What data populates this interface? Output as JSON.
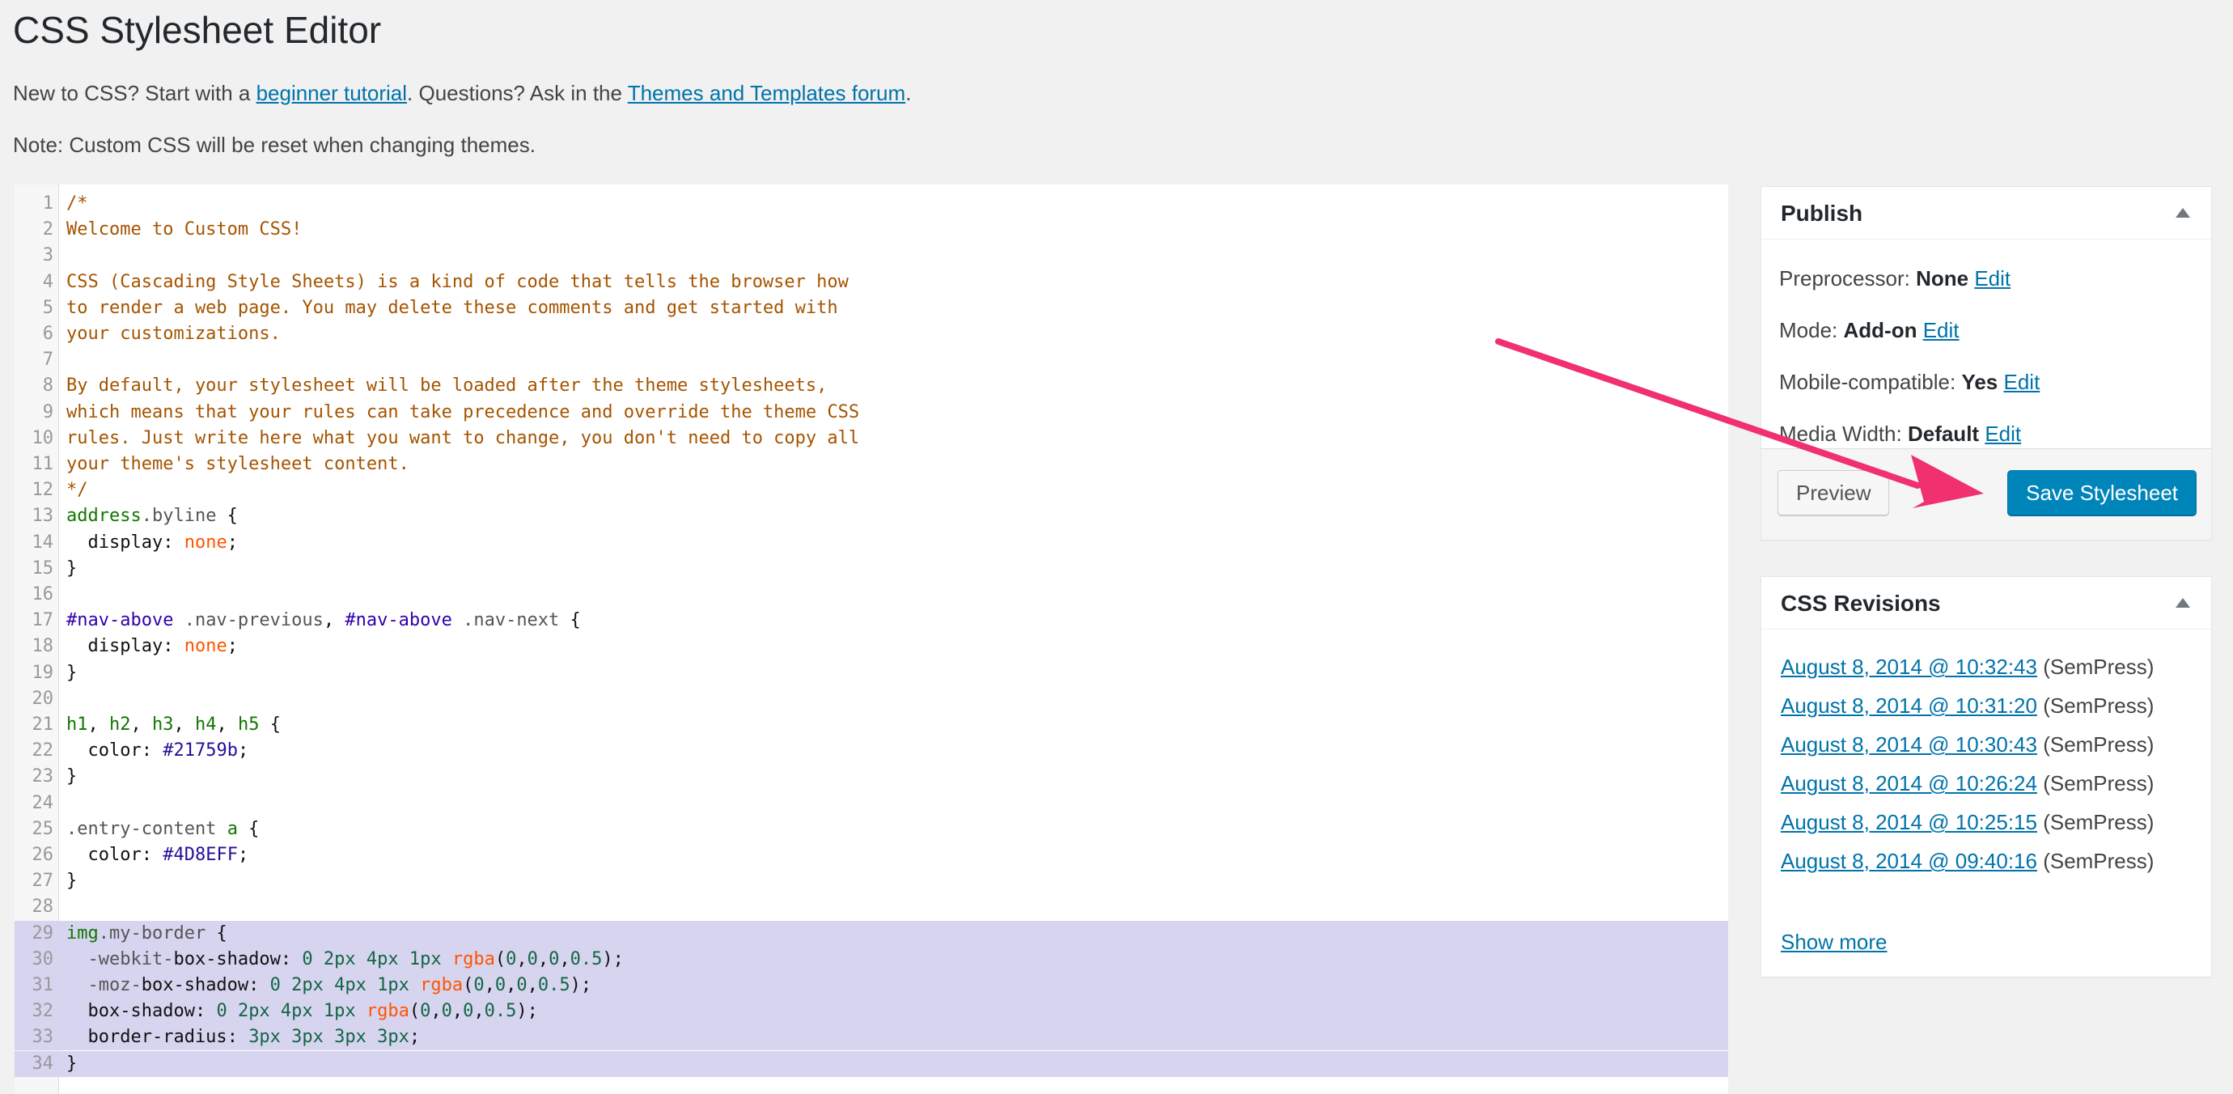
{
  "page": {
    "title": "CSS Stylesheet Editor",
    "intro_prefix": "New to CSS? Start with a ",
    "intro_link1": "beginner tutorial",
    "intro_middle": ". Questions? Ask in the ",
    "intro_link2": "Themes and Templates forum",
    "intro_suffix": ".",
    "note": "Note: Custom CSS will be reset when changing themes."
  },
  "editor": {
    "selected_lines": [
      29,
      30,
      31,
      32,
      33,
      34
    ],
    "lines": [
      [
        [
          "comment",
          "/*"
        ]
      ],
      [
        [
          "comment",
          "Welcome to Custom CSS!"
        ]
      ],
      [],
      [
        [
          "comment",
          "CSS (Cascading Style Sheets) is a kind of code that tells the browser how"
        ]
      ],
      [
        [
          "comment",
          "to render a web page. You may delete these comments and get started with"
        ]
      ],
      [
        [
          "comment",
          "your customizations."
        ]
      ],
      [],
      [
        [
          "comment",
          "By default, your stylesheet will be loaded after the theme stylesheets,"
        ]
      ],
      [
        [
          "comment",
          "which means that your rules can take precedence and override the theme CSS"
        ]
      ],
      [
        [
          "comment",
          "rules. Just write here what you want to change, you don't need to copy all"
        ]
      ],
      [
        [
          "comment",
          "your theme's stylesheet content."
        ]
      ],
      [
        [
          "comment",
          "*/"
        ]
      ],
      [
        [
          "tag",
          "address"
        ],
        [
          "qual",
          ".byline"
        ],
        [
          "punc",
          " {"
        ]
      ],
      [
        [
          "prop",
          "  display"
        ],
        [
          "punc",
          ": "
        ],
        [
          "atom",
          "none"
        ],
        [
          "punc",
          ";"
        ]
      ],
      [
        [
          "punc",
          "}"
        ]
      ],
      [],
      [
        [
          "builtin",
          "#nav-above"
        ],
        [
          "qual",
          " .nav-previous"
        ],
        [
          "punc",
          ", "
        ],
        [
          "builtin",
          "#nav-above"
        ],
        [
          "qual",
          " .nav-next"
        ],
        [
          "punc",
          " {"
        ]
      ],
      [
        [
          "prop",
          "  display"
        ],
        [
          "punc",
          ": "
        ],
        [
          "atom",
          "none"
        ],
        [
          "punc",
          ";"
        ]
      ],
      [
        [
          "punc",
          "}"
        ]
      ],
      [],
      [
        [
          "tag",
          "h1"
        ],
        [
          "punc",
          ", "
        ],
        [
          "tag",
          "h2"
        ],
        [
          "punc",
          ", "
        ],
        [
          "tag",
          "h3"
        ],
        [
          "punc",
          ", "
        ],
        [
          "tag",
          "h4"
        ],
        [
          "punc",
          ", "
        ],
        [
          "tag",
          "h5"
        ],
        [
          "punc",
          " {"
        ]
      ],
      [
        [
          "prop",
          "  color"
        ],
        [
          "punc",
          ": "
        ],
        [
          "hex",
          "#21759b"
        ],
        [
          "punc",
          ";"
        ]
      ],
      [
        [
          "punc",
          "}"
        ]
      ],
      [],
      [
        [
          "qual",
          ".entry-content"
        ],
        [
          "punc",
          " "
        ],
        [
          "tag",
          "a"
        ],
        [
          "punc",
          " {"
        ]
      ],
      [
        [
          "prop",
          "  color"
        ],
        [
          "punc",
          ": "
        ],
        [
          "hex",
          "#4D8EFF"
        ],
        [
          "punc",
          ";"
        ]
      ],
      [
        [
          "punc",
          "}"
        ]
      ],
      [],
      [
        [
          "tag",
          "img"
        ],
        [
          "qual",
          ".my-border"
        ],
        [
          "punc",
          " {"
        ]
      ],
      [
        [
          "qual",
          "  -webkit-"
        ],
        [
          "prop",
          "box-shadow"
        ],
        [
          "punc",
          ": "
        ],
        [
          "num",
          "0 2px 4px 1px"
        ],
        [
          "punc",
          " "
        ],
        [
          "atom",
          "rgba"
        ],
        [
          "punc",
          "("
        ],
        [
          "num",
          "0"
        ],
        [
          "punc",
          ","
        ],
        [
          "num",
          "0"
        ],
        [
          "punc",
          ","
        ],
        [
          "num",
          "0"
        ],
        [
          "punc",
          ","
        ],
        [
          "num",
          "0.5"
        ],
        [
          "punc",
          ");"
        ]
      ],
      [
        [
          "qual",
          "  -moz-"
        ],
        [
          "prop",
          "box-shadow"
        ],
        [
          "punc",
          ": "
        ],
        [
          "num",
          "0 2px 4px 1px"
        ],
        [
          "punc",
          " "
        ],
        [
          "atom",
          "rgba"
        ],
        [
          "punc",
          "("
        ],
        [
          "num",
          "0"
        ],
        [
          "punc",
          ","
        ],
        [
          "num",
          "0"
        ],
        [
          "punc",
          ","
        ],
        [
          "num",
          "0"
        ],
        [
          "punc",
          ","
        ],
        [
          "num",
          "0.5"
        ],
        [
          "punc",
          ");"
        ]
      ],
      [
        [
          "prop",
          "  box-shadow"
        ],
        [
          "punc",
          ": "
        ],
        [
          "num",
          "0 2px 4px 1px"
        ],
        [
          "punc",
          " "
        ],
        [
          "atom",
          "rgba"
        ],
        [
          "punc",
          "("
        ],
        [
          "num",
          "0"
        ],
        [
          "punc",
          ","
        ],
        [
          "num",
          "0"
        ],
        [
          "punc",
          ","
        ],
        [
          "num",
          "0"
        ],
        [
          "punc",
          ","
        ],
        [
          "num",
          "0.5"
        ],
        [
          "punc",
          ");"
        ]
      ],
      [
        [
          "prop",
          "  border-radius"
        ],
        [
          "punc",
          ": "
        ],
        [
          "num",
          "3px 3px 3px 3px"
        ],
        [
          "punc",
          ";"
        ]
      ],
      [
        [
          "punc",
          "}"
        ]
      ]
    ]
  },
  "publish": {
    "title": "Publish",
    "rows": [
      {
        "label": "Preprocessor: ",
        "value": "None",
        "edit": "Edit"
      },
      {
        "label": "Mode: ",
        "value": "Add-on",
        "edit": "Edit"
      },
      {
        "label": "Mobile-compatible: ",
        "value": "Yes",
        "edit": "Edit"
      },
      {
        "label": "Media Width: ",
        "value": "Default",
        "edit": "Edit"
      }
    ],
    "preview_label": "Preview",
    "save_label": "Save Stylesheet"
  },
  "revisions": {
    "title": "CSS Revisions",
    "items": [
      {
        "date": "August 8, 2014 @ 10:32:43",
        "theme": "(SemPress)"
      },
      {
        "date": "August 8, 2014 @ 10:31:20",
        "theme": "(SemPress)"
      },
      {
        "date": "August 8, 2014 @ 10:30:43",
        "theme": "(SemPress)"
      },
      {
        "date": "August 8, 2014 @ 10:26:24",
        "theme": "(SemPress)"
      },
      {
        "date": "August 8, 2014 @ 10:25:15",
        "theme": "(SemPress)"
      },
      {
        "date": "August 8, 2014 @ 09:40:16",
        "theme": "(SemPress)"
      }
    ],
    "show_more": "Show more"
  },
  "colors": {
    "accent": "#0085ba",
    "link": "#0073aa",
    "arrow": "#f0306f",
    "selection": "#d7d4f0"
  }
}
